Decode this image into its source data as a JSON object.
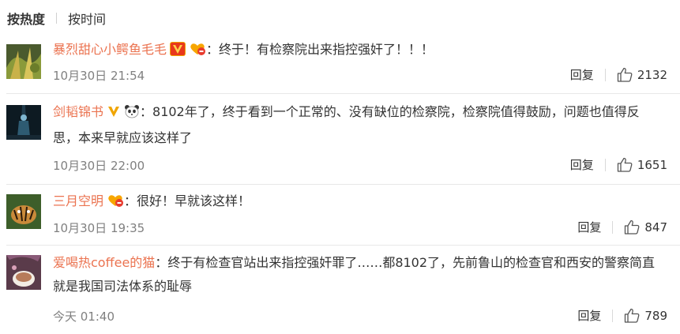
{
  "tabs": {
    "hot": "按热度",
    "time": "按时间"
  },
  "comments": [
    {
      "username": "暴烈甜心小鳄鱼毛毛",
      "badges": [
        "vip-v-icon",
        "heart-member-icon"
      ],
      "text": "：终于！有检察院出来指控强奸了！！！",
      "time": "10月30日 21:54",
      "reply_label": "回复",
      "likes": "2132"
    },
    {
      "username": "剑韬锦书",
      "badges": [
        "verified-v-icon",
        "panda-icon"
      ],
      "text": "：8102年了，终于看到一个正常的、没有缺位的检察院，检察院值得鼓励，问题也值得反思，本来早就应该这样了",
      "time": "10月30日 22:00",
      "reply_label": "回复",
      "likes": "1651"
    },
    {
      "username": "三月空明",
      "badges": [
        "heart-member-icon"
      ],
      "text": "：很好！早就该这样！",
      "time": "10月30日 19:35",
      "reply_label": "回复",
      "likes": "847"
    },
    {
      "username": "爱喝热coffee的猫",
      "badges": [],
      "text": "：终于有检查官站出来指控强奸罪了……都8102了，先前鲁山的检查官和西安的警察简直就是我国司法体系的耻辱",
      "time": "今天 01:40",
      "reply_label": "回复",
      "likes": "789"
    }
  ],
  "colors": {
    "username": "#eb7350",
    "meta": "#808080",
    "divider": "#e8e8e8"
  }
}
